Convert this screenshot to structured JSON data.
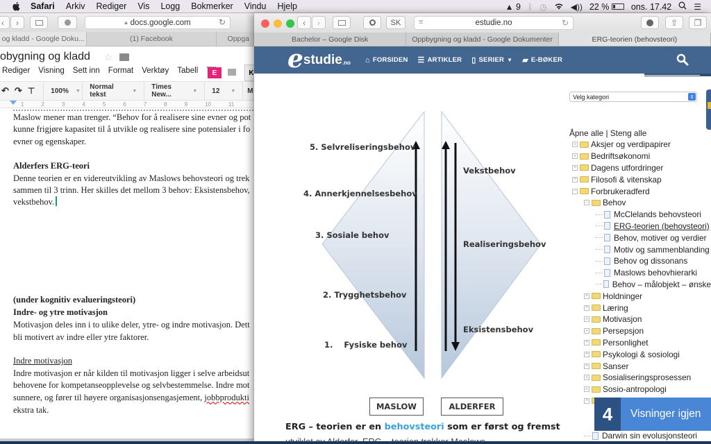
{
  "menubar": {
    "app": "Safari",
    "items": [
      "Arkiv",
      "Rediger",
      "Vis",
      "Logg",
      "Bokmerker",
      "Vindu",
      "Hjelp"
    ],
    "status": {
      "adobe_count": "9",
      "battery": "22 %",
      "clock": "ons. 17.42"
    }
  },
  "left_window": {
    "url": "docs.google.com",
    "tabs": [
      "og kladd - Google Doku...",
      "(1) Facebook",
      "Oppga"
    ],
    "doc_title": "obygning og kladd",
    "menu": [
      "Rediger",
      "Visning",
      "Sett inn",
      "Format",
      "Verktøy",
      "Tabell",
      "Tille"
    ],
    "user_badge": "E",
    "side_button": "K",
    "format_toolbar": {
      "zoom": "100%",
      "style": "Normal tekst",
      "font": "Times New...",
      "size": "12",
      "more": "M"
    },
    "ruler": [
      "1",
      "2",
      "3",
      "4",
      "5",
      "6",
      "7",
      "8",
      "9",
      "10",
      "11"
    ],
    "paragraphs": [
      {
        "text": "Maslow mener man trenger. “Behov for å realisere sine evner og pot",
        "style": "normal"
      },
      {
        "text": "kunne frigjøre kapasitet til å utvikle og realisere sine potensialer i fo",
        "style": "normal"
      },
      {
        "text": "evner og egenskaper.",
        "style": "normal"
      },
      {
        "text": "Alderfers ERG-teori",
        "style": "bold"
      },
      {
        "text": "Denne teorien er en videreutvikling av Maslows behovsteori og trek",
        "style": "normal"
      },
      {
        "text": "sammen til 3 trinn. Her skilles det mellom 3 behov: Eksistensbehov,",
        "style": "normal"
      },
      {
        "text": "vekstbehov.",
        "style": "normal"
      },
      {
        "text": "(under kognitiv evalueringsteori)",
        "style": "bold"
      },
      {
        "text": "Indre- og ytre motivasjon",
        "style": "bold"
      },
      {
        "text": "Motivasjon deles inn i to ulike deler, ytre- og indre motivasjon. Dett",
        "style": "normal"
      },
      {
        "text": "bli motivert av indre eller ytre faktorer.",
        "style": "normal"
      },
      {
        "text": "Indre motivasjon",
        "style": "underline"
      },
      {
        "text": "Indre motivasjon er når kilden til motivasjon ligger i selve arbeidsut",
        "style": "normal"
      },
      {
        "text": "behovene for kompetanseopplevelse og selvbestemmelse. Indre mot",
        "style": "normal"
      },
      {
        "text": "sunnere, og fører til høyere organisasjonsengasjement, ",
        "style": "normal",
        "spell": "jobbprodukti"
      },
      {
        "text": "ekstra tak.",
        "style": "normal"
      }
    ]
  },
  "right_window": {
    "url": "estudie.no",
    "ext_label": "SK",
    "tabs": [
      "Bachelor – Google Disk",
      "Oppbygning og kladd - Google Dokumenter",
      "ERG-teorien (behovsteori)"
    ],
    "active_tab": 2,
    "logo": {
      "e": "e",
      "main": "studie",
      "suffix": ".no"
    },
    "nav": [
      "FORSIDEN",
      "ARTIKLER",
      "SERIER",
      "E-BØKER"
    ],
    "category_select": "Velg kategori",
    "tree_header": "Åpne alle | Steng alle",
    "tree": [
      {
        "label": "Aksjer og verdipapirer",
        "level": 0,
        "type": "folder",
        "open": false
      },
      {
        "label": "Bedriftsøkonomi",
        "level": 0,
        "type": "folder",
        "open": false
      },
      {
        "label": "Dagens utfordringer",
        "level": 0,
        "type": "folder",
        "open": false
      },
      {
        "label": "Filosofi & vitenskap",
        "level": 0,
        "type": "folder",
        "open": false
      },
      {
        "label": "Forbrukeradferd",
        "level": 0,
        "type": "folder",
        "open": true
      },
      {
        "label": "Behov",
        "level": 1,
        "type": "folder",
        "open": true
      },
      {
        "label": "McClelands behovsteori",
        "level": 2,
        "type": "page"
      },
      {
        "label": "ERG-teorien (behovsteori)",
        "level": 2,
        "type": "page",
        "current": true
      },
      {
        "label": "Behov, motiver og verdier",
        "level": 2,
        "type": "page"
      },
      {
        "label": "Motiv og sammenblanding",
        "level": 2,
        "type": "page"
      },
      {
        "label": "Behov og dissonans",
        "level": 2,
        "type": "page"
      },
      {
        "label": "Maslows behovhierarki",
        "level": 2,
        "type": "page"
      },
      {
        "label": "Behov – målobjekt – ønske",
        "level": 2,
        "type": "page"
      },
      {
        "label": "Holdninger",
        "level": 1,
        "type": "folder",
        "open": false
      },
      {
        "label": "Læring",
        "level": 1,
        "type": "folder",
        "open": false
      },
      {
        "label": "Motivasjon",
        "level": 1,
        "type": "folder",
        "open": false
      },
      {
        "label": "Persepsjon",
        "level": 1,
        "type": "folder",
        "open": false
      },
      {
        "label": "Personlighet",
        "level": 1,
        "type": "folder",
        "open": false
      },
      {
        "label": "Psykologi & sosiologi",
        "level": 1,
        "type": "folder",
        "open": false
      },
      {
        "label": "Sanser",
        "level": 1,
        "type": "folder",
        "open": false
      },
      {
        "label": "Sosialiseringsprosessen",
        "level": 1,
        "type": "folder",
        "open": false
      },
      {
        "label": "Sosio-antropologi",
        "level": 1,
        "type": "folder",
        "open": false
      },
      {
        "label": "",
        "level": 1,
        "type": "folder",
        "open": false
      },
      {
        "label": "",
        "level": 2,
        "type": "page"
      },
      {
        "label": "",
        "level": 2,
        "type": "page"
      },
      {
        "label": "Darwin sin evolusjonsteori",
        "level": 1,
        "type": "page"
      }
    ],
    "views_popup": {
      "count": "4",
      "label": "Visninger igjen"
    },
    "diagram": {
      "maslow_levels": [
        "5. Selvreliseringsbehov",
        "4. Annerkjennelsesbehov",
        "3. Sosiale behov",
        "2. Trygghetsbehov",
        "1.    Fysiske behov"
      ],
      "alderfer_levels": [
        "Vekstbehov",
        "Realiseringsbehov",
        "Eksistensbehov"
      ],
      "left_box": "MASLOW",
      "right_box": "ALDERFER"
    },
    "article": {
      "line1_pre": "ERG – teorien er en ",
      "line1_link": "behovsteori",
      "line1_post": " som er først og fremst",
      "line2": "utviklet av Alderfer. ERG – teorien trekker Maslows"
    }
  }
}
